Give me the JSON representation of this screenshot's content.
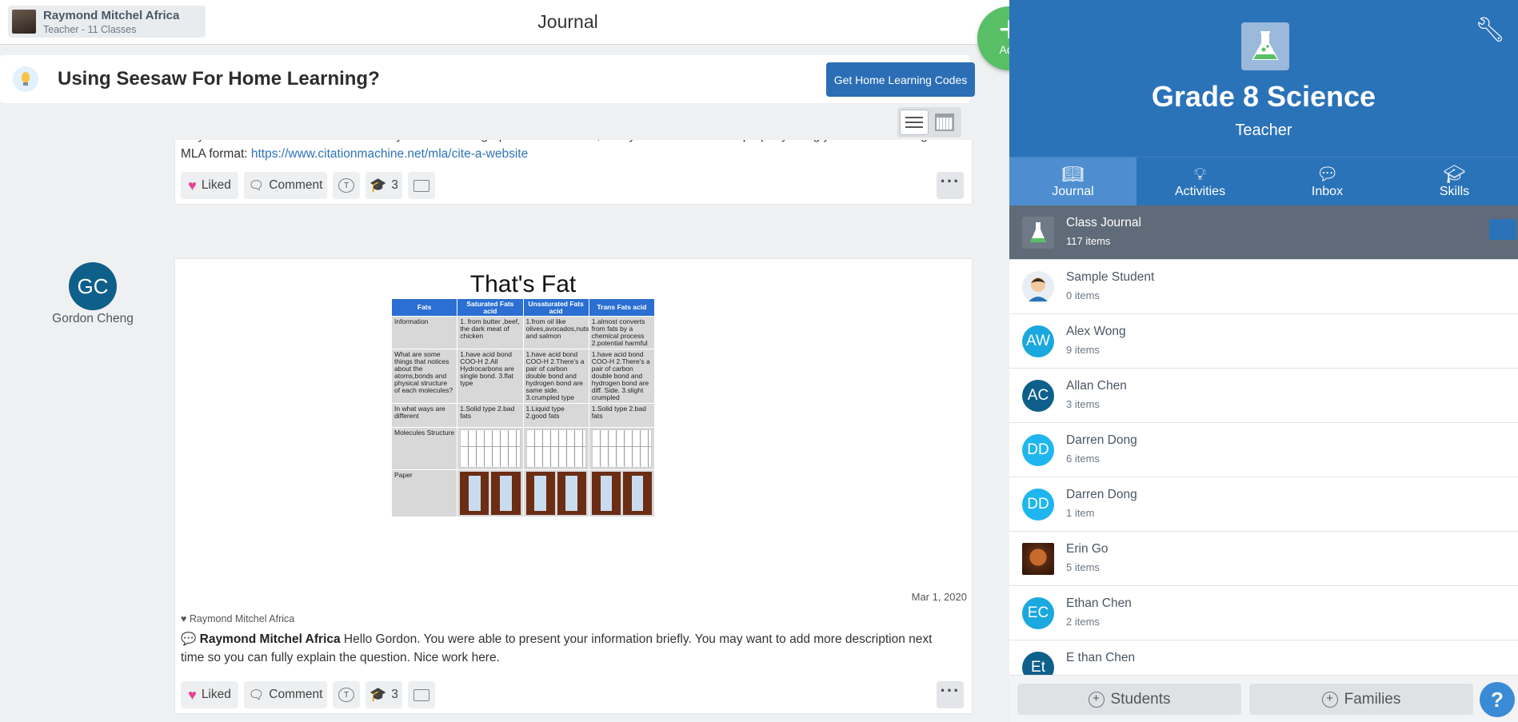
{
  "header": {
    "user_name": "Raymond Mitchel Africa",
    "user_sub": "Teacher - 11 Classes",
    "page_title": "Journal"
  },
  "banner": {
    "text": "Using Seesaw For Home Learning?",
    "button": "Get Home Learning Codes"
  },
  "add_button": {
    "icon": "plus-icon",
    "label": "Add"
  },
  "feed": {
    "post1": {
      "text_before_link": "may want to check out how to effectively create an infographic. Furthermore, kindly chech thos cite for properly citing your sources using MLA format: ",
      "link": "https://www.citationmachine.net/mla/cite-a-website",
      "actions": {
        "liked": "Liked",
        "comment": "Comment",
        "skills_count": "3"
      }
    },
    "post2": {
      "author_initials": "GC",
      "author_name": "Gordon Cheng",
      "infographic": {
        "title": "That's Fat",
        "headers": [
          "Fats",
          "Saturated Fats acid",
          "Unsaturated Fats acid",
          "Trans Fats acid"
        ],
        "rows": [
          [
            "Information",
            "1. from butter ,beef, the dark meat of chicken",
            "1.from oil like olives,avocados,nuts and salmon",
            "1.almost converts from fats by a chemical process 2.potential harmful"
          ],
          [
            "What are some things that notices about the atoms,bonds and physical structure of each molecules?",
            "1.have acid bond COO-H 2.All Hydrocarbons are single bond. 3.flat type",
            "1.have acid bond COO-H 2.There's a pair of carbon double bond and hydrogen bond are same side. 3.crumpled type",
            "1.have acid bond COO-H 2.There's a pair of carbon double bond and hydrogen bond are diff. Side. 3.slight crumpled"
          ],
          [
            "In what ways are different",
            "1.Solid type 2.bad fats",
            "1.Liquid type 2.good fats",
            "1.Solid type 2.bad fats"
          ]
        ],
        "row_molecules": "Molecules Structure",
        "row_paper": "Paper"
      },
      "date": "Mar 1, 2020",
      "liked_by": "Raymond Mitchel Africa",
      "comment_author": "Raymond Mitchel Africa",
      "comment_text": " Hello Gordon. You were able to present your information briefly. You may want to add more description next time so you can fully explain the question. Nice work here.",
      "actions": {
        "liked": "Liked",
        "comment": "Comment",
        "skills_count": "3"
      }
    }
  },
  "sidebar": {
    "class_name": "Grade 8 Science",
    "role": "Teacher",
    "tabs": [
      {
        "label": "Journal",
        "icon": "book-icon"
      },
      {
        "label": "Activities",
        "icon": "lightbulb-icon"
      },
      {
        "label": "Inbox",
        "icon": "chat-icon"
      },
      {
        "label": "Skills",
        "icon": "graduation-cap-icon"
      }
    ],
    "items": [
      {
        "name": "Class Journal",
        "count": "117 items"
      },
      {
        "name": "Sample Student",
        "count": "0 items"
      },
      {
        "name": "Alex Wong",
        "count": "9 items",
        "initials": "AW"
      },
      {
        "name": "Allan Chen",
        "count": "3 items",
        "initials": "AC"
      },
      {
        "name": "Darren Dong",
        "count": "6 items",
        "initials": "DD"
      },
      {
        "name": "Darren Dong",
        "count": "1 item",
        "initials": "DD"
      },
      {
        "name": "Erin Go",
        "count": "5 items"
      },
      {
        "name": "Ethan Chen",
        "count": "2 items",
        "initials": "EC"
      },
      {
        "name": "E than Chen",
        "count": "",
        "initials": "Et"
      }
    ],
    "footer": {
      "students": "Students",
      "families": "Families",
      "help": "?"
    }
  },
  "colors": {
    "brand_blue": "#2b73b8",
    "add_green": "#59bf66",
    "avatar_dark": "#0e5f8a",
    "avatar_light": "#1aa8de",
    "like_pink": "#e84393"
  }
}
